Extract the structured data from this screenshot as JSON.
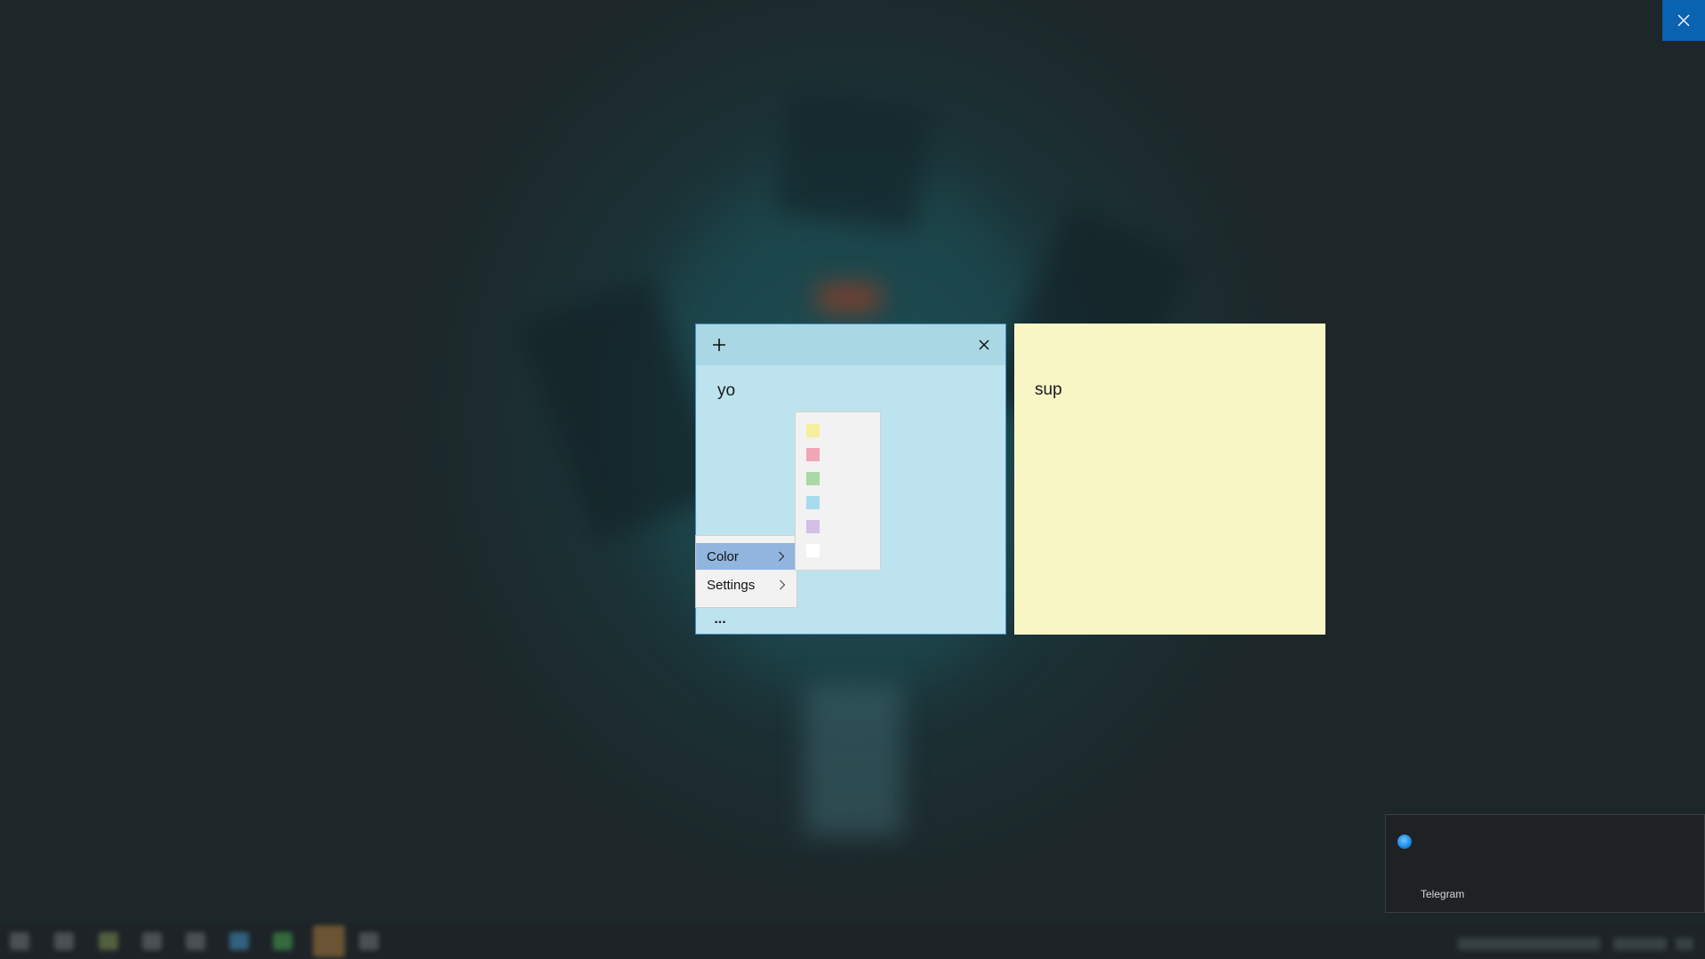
{
  "desktop": {
    "close_overlay_icon": "close-icon"
  },
  "notes": [
    {
      "color": "#bde4ee",
      "header_color": "#a9d8e4",
      "add_icon": "plus-icon",
      "close_icon": "close-icon",
      "text": "yo",
      "more_label": "..."
    },
    {
      "color": "#f9f6c6",
      "text": "sup"
    }
  ],
  "context_menu": {
    "items": [
      {
        "label": "Color",
        "highlighted": true,
        "has_submenu": true
      },
      {
        "label": "Settings",
        "highlighted": false,
        "has_submenu": true
      }
    ]
  },
  "color_submenu": {
    "swatches": [
      "#f6ef9e",
      "#f0a6b6",
      "#a9d9a6",
      "#a7dbee",
      "#d1bfe6",
      "#ffffff"
    ]
  },
  "notification": {
    "app_name": "Telegram",
    "icon": "telegram-icon"
  },
  "taskbar": {
    "icons": [
      "app-icon-1",
      "app-icon-2",
      "app-icon-3",
      "app-icon-4",
      "app-icon-5",
      "app-icon-6",
      "app-icon-7",
      "app-icon-8",
      "app-icon-9"
    ]
  }
}
